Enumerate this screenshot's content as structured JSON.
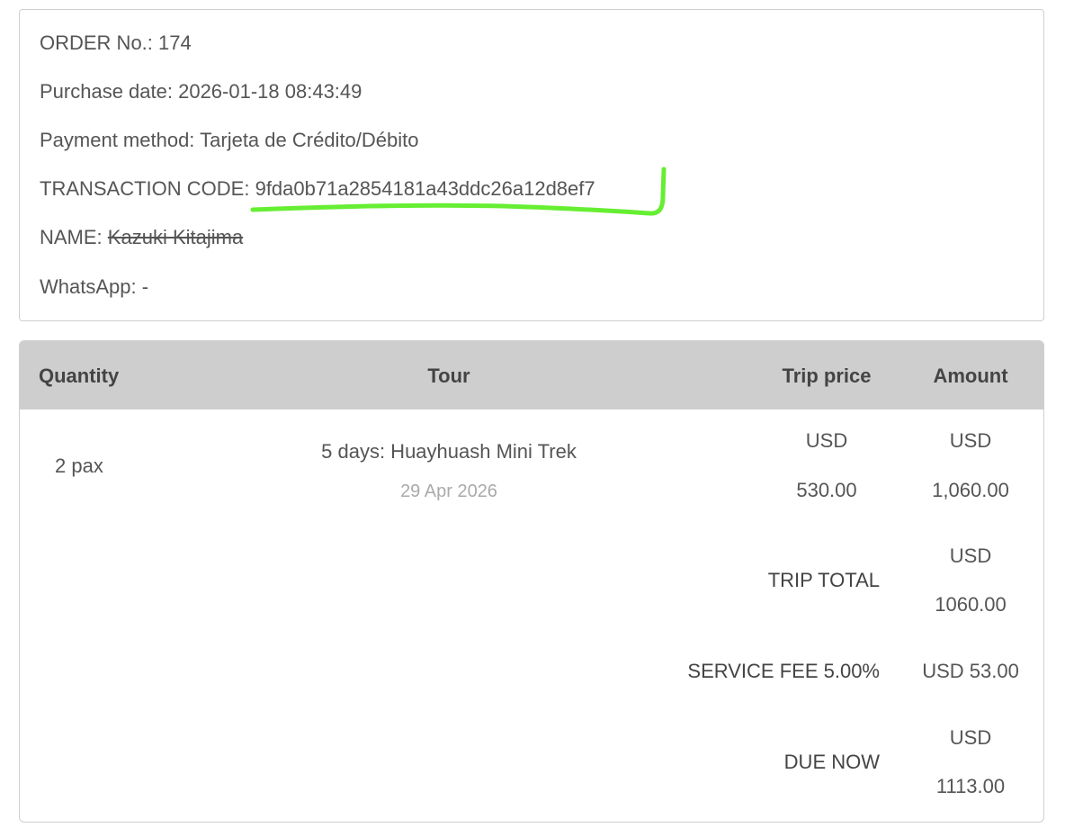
{
  "order": {
    "order_no": "ORDER No.: 174",
    "purchase_date": "Purchase date: 2026-01-18 08:43:49",
    "payment_method": "Payment method: Tarjeta de Crédito/Débito",
    "transaction_label": "TRANSACTION CODE: ",
    "transaction_code": "9fda0b71a2854181a43ddc26a12d8ef7",
    "name_label": "NAME: ",
    "name_value": "Kazuki Kitajima",
    "whatsapp": "WhatsApp: -"
  },
  "colors": {
    "highlight": "#66ee33",
    "header_bg": "#cecece",
    "text": "#555555",
    "muted": "#aaaaaa"
  },
  "table": {
    "headers": {
      "quantity": "Quantity",
      "tour": "Tour",
      "trip_price": "Trip price",
      "amount": "Amount"
    },
    "row": {
      "quantity": "2 pax",
      "tour_name": "5 days: Huayhuash Mini Trek",
      "tour_date": "29 Apr 2026",
      "price_currency": "USD",
      "price_value": "530.00",
      "amount_currency": "USD",
      "amount_value": "1,060.00"
    },
    "trip_total": {
      "label": "TRIP TOTAL",
      "currency": "USD",
      "value": "1060.00"
    },
    "service_fee": {
      "label": "SERVICE FEE 5.00%",
      "value": "USD 53.00"
    },
    "due_now": {
      "label": "DUE NOW",
      "currency": "USD",
      "value": "1113.00"
    }
  }
}
